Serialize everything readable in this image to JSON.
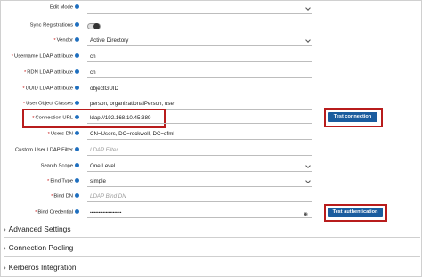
{
  "form": {
    "edit_mode": {
      "label": "Edit Mode",
      "value": ""
    },
    "sync_registrations": {
      "label": "Sync Registrations",
      "enabled": false
    },
    "vendor": {
      "label": "Vendor",
      "value": "Active Directory"
    },
    "username_attr": {
      "label": "Username LDAP attribute",
      "value": "cn"
    },
    "rdn_attr": {
      "label": "RDN LDAP attribute",
      "value": "cn"
    },
    "uuid_attr": {
      "label": "UUID LDAP attribute",
      "value": "objectGUID"
    },
    "user_object_classes": {
      "label": "User Object Classes",
      "value": "person, organizationalPerson, user"
    },
    "connection_url": {
      "label": "Connection URL",
      "value": "ldap://192.168.10.45:389"
    },
    "users_dn": {
      "label": "Users DN",
      "value": "CN=Users, DC=rockwell, DC=dfml"
    },
    "custom_filter": {
      "label": "Custom User LDAP Filter",
      "placeholder": "LDAP Filter"
    },
    "search_scope": {
      "label": "Search Scope",
      "value": "One Level"
    },
    "bind_type": {
      "label": "Bind Type",
      "value": "simple"
    },
    "bind_dn": {
      "label": "Bind DN",
      "placeholder": "LDAP Bind DN"
    },
    "bind_credential": {
      "label": "Bind Credential",
      "value": "••••••••••••••••••••••"
    }
  },
  "buttons": {
    "test_connection": "Test connection",
    "test_authentication": "Test authentication"
  },
  "sections": [
    {
      "label": "Advanced Settings"
    },
    {
      "label": "Connection Pooling"
    },
    {
      "label": "Kerberos Integration"
    }
  ],
  "icons": {
    "info": "info-icon",
    "eye": "eye-icon",
    "chevron": "chevron-down-icon",
    "expand": "chevron-right-icon"
  },
  "colors": {
    "accent": "#1a5c9e",
    "highlight": "#b81c1c",
    "required": "#cc2a2a"
  }
}
